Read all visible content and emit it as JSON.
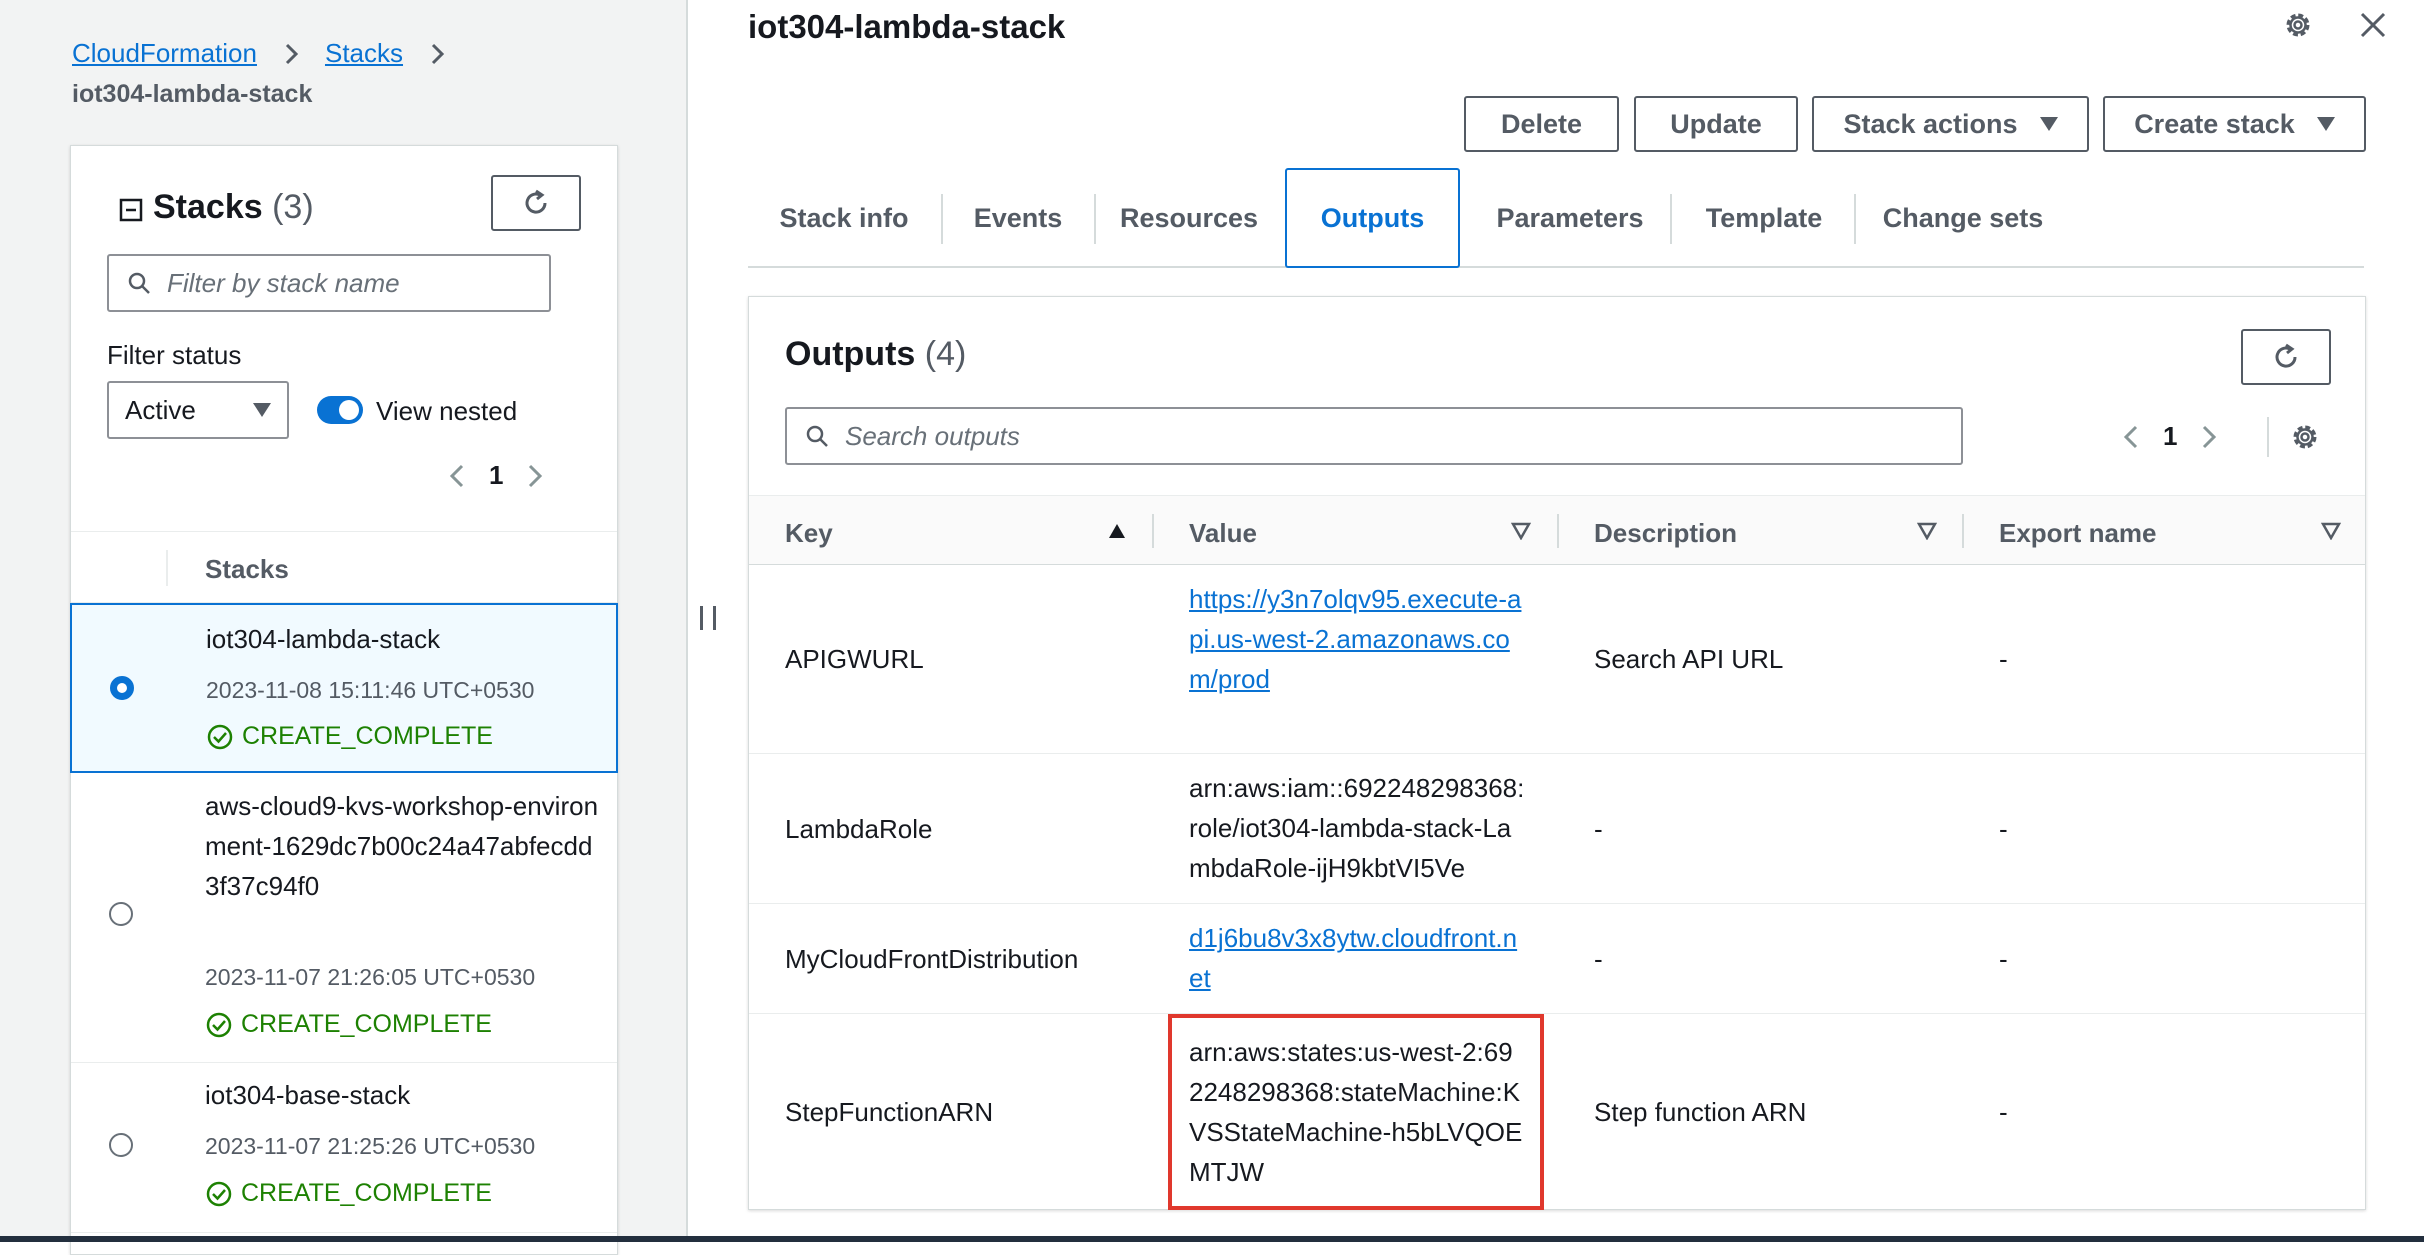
{
  "breadcrumb": {
    "items": [
      "CloudFormation",
      "Stacks"
    ],
    "current": "iot304-lambda-stack"
  },
  "stacks_panel": {
    "title": "Stacks",
    "count": "(3)",
    "filter_placeholder": "Filter by stack name",
    "filter_status_label": "Filter status",
    "status_value": "Active",
    "view_nested_label": "View nested",
    "page": "1",
    "column_header": "Stacks",
    "rows": [
      {
        "name": "iot304-lambda-stack",
        "time": "2023-11-08 15:11:46 UTC+0530",
        "status": "CREATE_COMPLETE"
      },
      {
        "name": "aws-cloud9-kvs-workshop-environment-1629dc7b00c24a47abfecdd3f37c94f0",
        "time": "2023-11-07 21:26:05 UTC+0530",
        "status": "CREATE_COMPLETE"
      },
      {
        "name": "iot304-base-stack",
        "time": "2023-11-07 21:25:26 UTC+0530",
        "status": "CREATE_COMPLETE"
      }
    ]
  },
  "main": {
    "title": "iot304-lambda-stack",
    "actions": {
      "delete": "Delete",
      "update": "Update",
      "stack_actions": "Stack actions",
      "create_stack": "Create stack"
    },
    "tabs": [
      "Stack info",
      "Events",
      "Resources",
      "Outputs",
      "Parameters",
      "Template",
      "Change sets"
    ],
    "active_tab": "Outputs"
  },
  "outputs": {
    "title": "Outputs",
    "count": "(4)",
    "search_placeholder": "Search outputs",
    "page": "1",
    "columns": [
      "Key",
      "Value",
      "Description",
      "Export name"
    ],
    "rows": [
      {
        "key": "APIGWURL",
        "value": "https://y3n7olqv95.execute-api.us-west-2.amazonaws.com/prod",
        "description": "Search API URL",
        "export": "-"
      },
      {
        "key": "LambdaRole",
        "value": "arn:aws:iam::692248298368:role/iot304-lambda-stack-LambdaRole-ijH9kbtVI5Ve",
        "description": "-",
        "export": "-"
      },
      {
        "key": "MyCloudFrontDistribution",
        "value": "d1j6bu8v3x8ytw.cloudfront.net",
        "description": "-",
        "export": "-"
      },
      {
        "key": "StepFunctionARN",
        "value": "arn:aws:states:us-west-2:692248298368:stateMachine:KVSStateMachine-h5bLVQOEMTJW",
        "description": "Step function ARN",
        "export": "-"
      }
    ]
  },
  "colors": {
    "link": "#0972d3",
    "success": "#1d8102",
    "highlight": "#e0382d"
  },
  "icons": [
    "chevron-right-icon",
    "collapse-icon",
    "refresh-icon",
    "search-icon",
    "caret-down-icon",
    "chevron-left-icon",
    "check-circle-icon",
    "settings-icon",
    "close-icon",
    "sort-ascending-icon",
    "sort-icon"
  ]
}
